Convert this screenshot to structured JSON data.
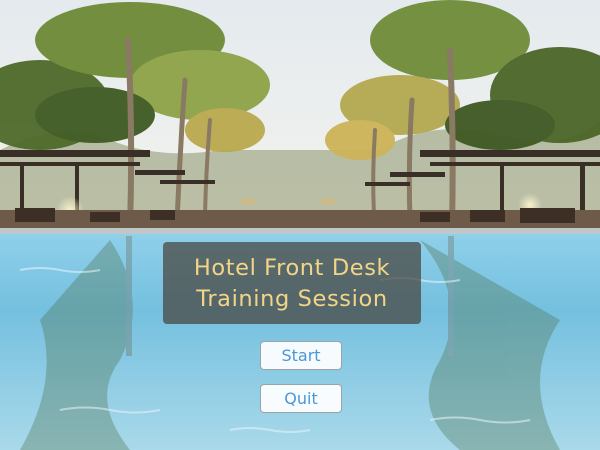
{
  "title_panel": {
    "line1": "Hotel Front Desk",
    "line2": "Training Session"
  },
  "menu": {
    "start_label": "Start",
    "quit_label": "Quit"
  },
  "colors": {
    "title_text": "#f3d586",
    "button_text": "#4a98d8",
    "button_border": "#9aa3aa",
    "pool_water": "#7cc4e0",
    "sky": "#eef2f4"
  }
}
